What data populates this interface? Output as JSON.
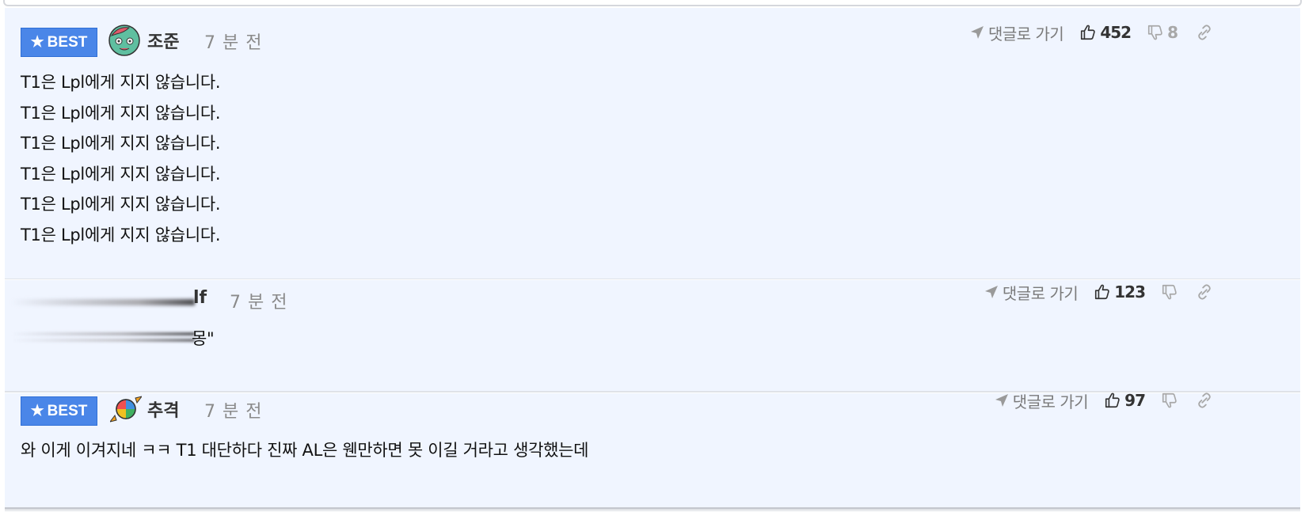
{
  "comments": [
    {
      "best_label": "BEST",
      "username": "조준",
      "timestamp": "7 분 전",
      "reply_label": "댓글로 가기",
      "likes": "452",
      "dislikes": "8",
      "avatar": "zombie-face-avatar",
      "lines": [
        "T1은 Lpl에게 지지 않습니다.",
        "T1은 Lpl에게 지지 않습니다.",
        "T1은 Lpl에게 지지 않습니다.",
        "T1은 Lpl에게 지지 않습니다.",
        "T1은 Lpl에게 지지 않습니다.",
        "T1은 Lpl에게 지지 않습니다."
      ]
    },
    {
      "username": "lf",
      "timestamp": "7 분 전",
      "reply_label": "댓글로 가기",
      "likes": "123",
      "text": "몽\""
    },
    {
      "best_label": "BEST",
      "username": "추격",
      "timestamp": "7 분 전",
      "reply_label": "댓글로 가기",
      "likes": "97",
      "avatar": "candy-avatar",
      "text": "와 이게 이겨지네 ㅋㅋ T1 대단하다 진짜 AL은 웬만하면 못 이길 거라고 생각했는데"
    }
  ],
  "icons": {
    "reply": "send-arrow-icon",
    "like": "thumbs-up-icon",
    "dislike": "thumbs-down-icon",
    "link": "link-icon",
    "best": "star-icon"
  },
  "colors": {
    "best_badge": "#4a86e8",
    "comment_bg": "#f0f5ff"
  }
}
